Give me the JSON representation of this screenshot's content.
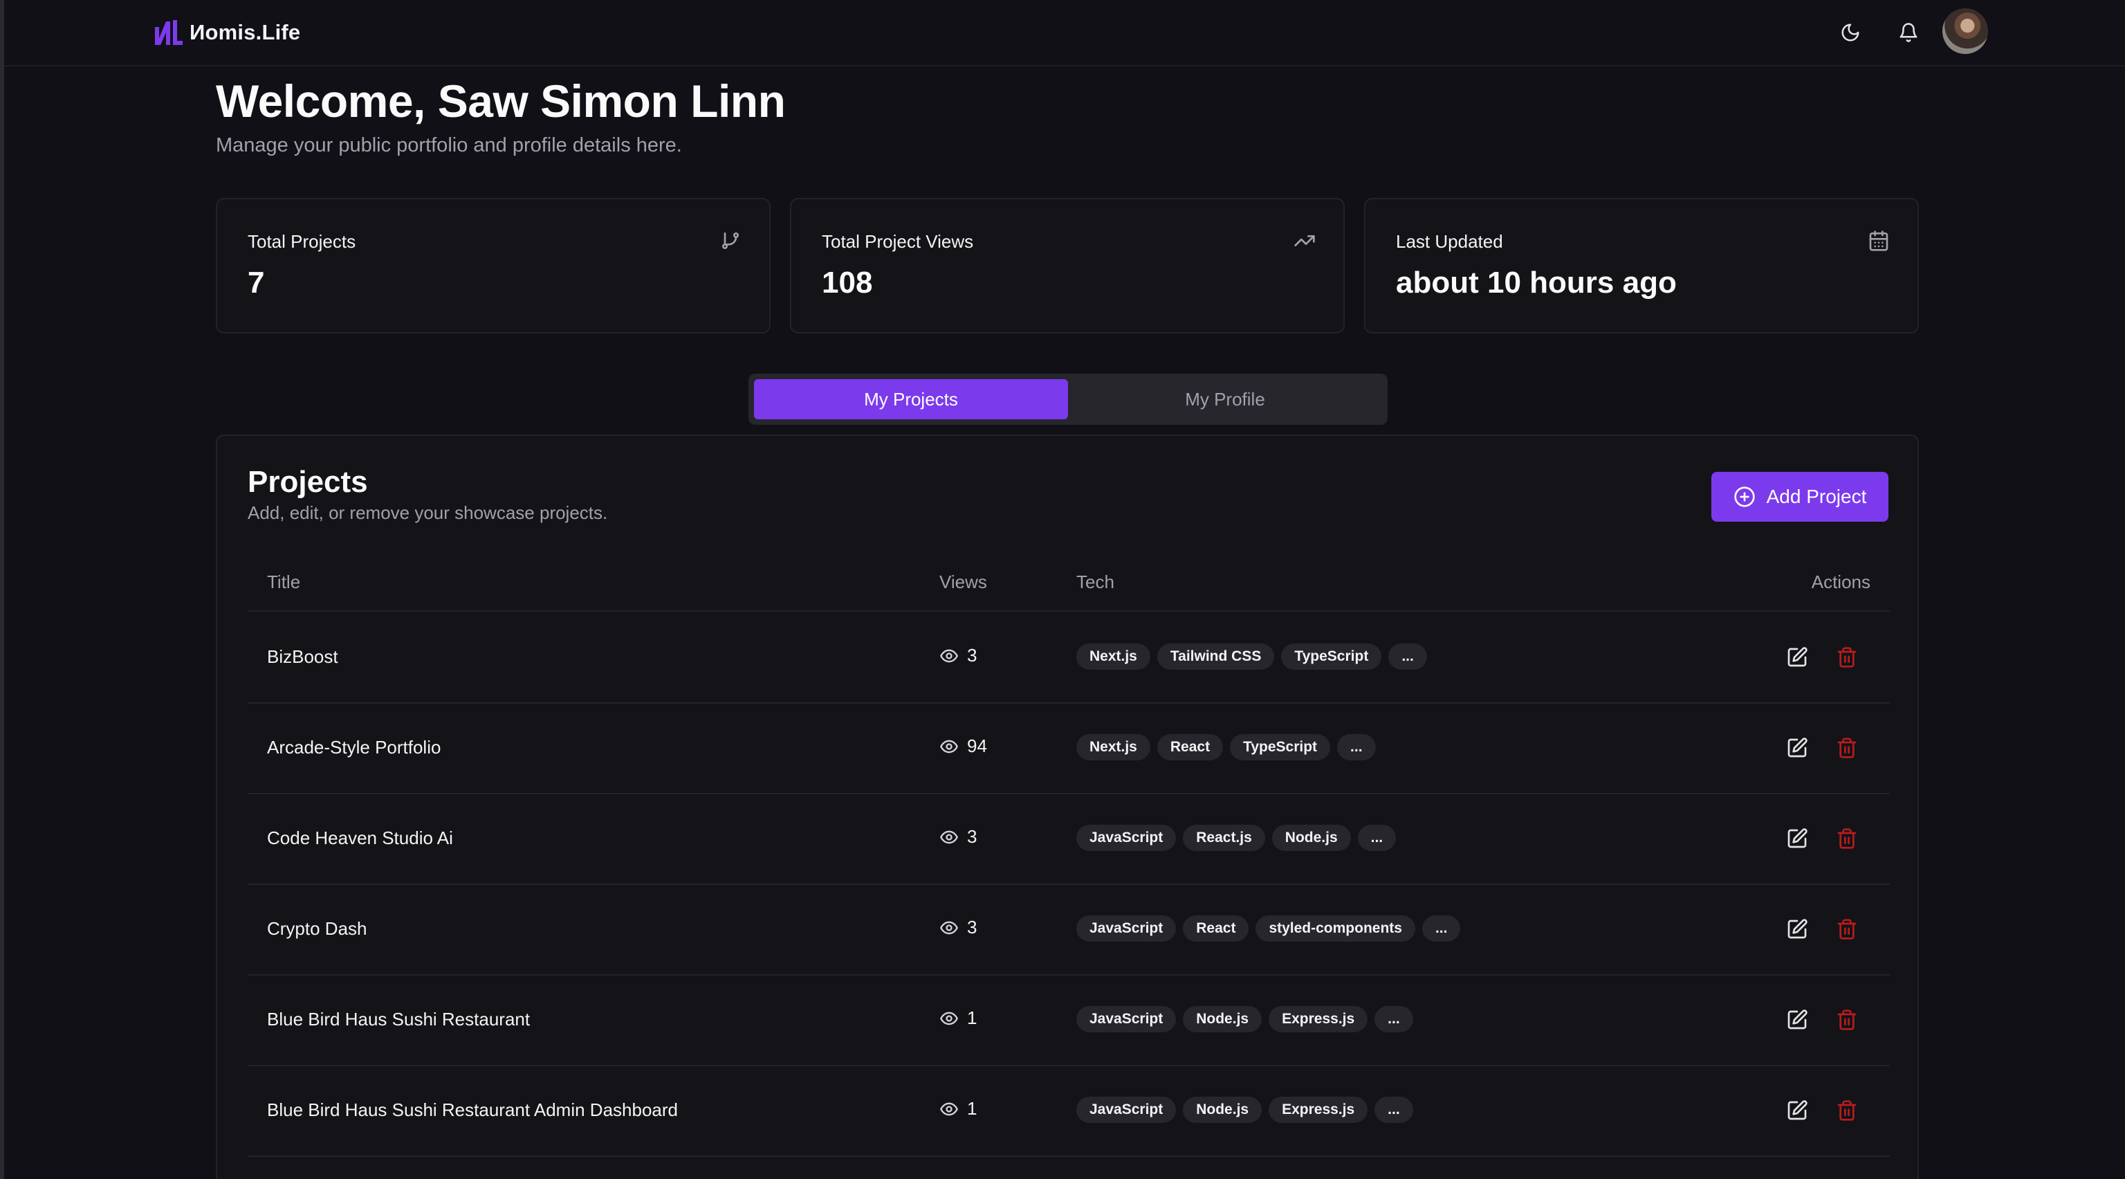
{
  "header": {
    "logo_text": "Иomis.Life",
    "icons": [
      "moon-icon",
      "bell-icon",
      "avatar"
    ]
  },
  "welcome": {
    "title": "Welcome, Saw Simon Linn",
    "subtitle": "Manage your public portfolio and profile details here."
  },
  "stats": [
    {
      "label": "Total Projects",
      "value": "7",
      "icon": "git-fork-icon"
    },
    {
      "label": "Total Project Views",
      "value": "108",
      "icon": "trending-up-icon"
    },
    {
      "label": "Last Updated",
      "value": "about 10 hours ago",
      "icon": "calendar-icon"
    }
  ],
  "tabs": [
    {
      "label": "My Projects",
      "active": true
    },
    {
      "label": "My Profile",
      "active": false
    }
  ],
  "projects": {
    "title": "Projects",
    "subtitle": "Add, edit, or remove your showcase projects.",
    "add_label": "Add Project",
    "columns": {
      "title": "Title",
      "views": "Views",
      "tech": "Tech",
      "actions": "Actions"
    },
    "rows": [
      {
        "title": "BizBoost",
        "views": "3",
        "tech": [
          "Next.js",
          "Tailwind CSS",
          "TypeScript",
          "..."
        ]
      },
      {
        "title": "Arcade-Style Portfolio",
        "views": "94",
        "tech": [
          "Next.js",
          "React",
          "TypeScript",
          "..."
        ]
      },
      {
        "title": "Code Heaven Studio Ai",
        "views": "3",
        "tech": [
          "JavaScript",
          "React.js",
          "Node.js",
          "..."
        ]
      },
      {
        "title": "Crypto Dash",
        "views": "3",
        "tech": [
          "JavaScript",
          "React",
          "styled-components",
          "..."
        ]
      },
      {
        "title": "Blue Bird Haus Sushi Restaurant",
        "views": "1",
        "tech": [
          "JavaScript",
          "Node.js",
          "Express.js",
          "..."
        ]
      },
      {
        "title": "Blue Bird Haus Sushi Restaurant Admin Dashboard",
        "views": "1",
        "tech": [
          "JavaScript",
          "Node.js",
          "Express.js",
          "..."
        ]
      }
    ]
  },
  "colors": {
    "accent": "#7c3aed",
    "delete": "#b91c1c",
    "background": "#111016"
  }
}
